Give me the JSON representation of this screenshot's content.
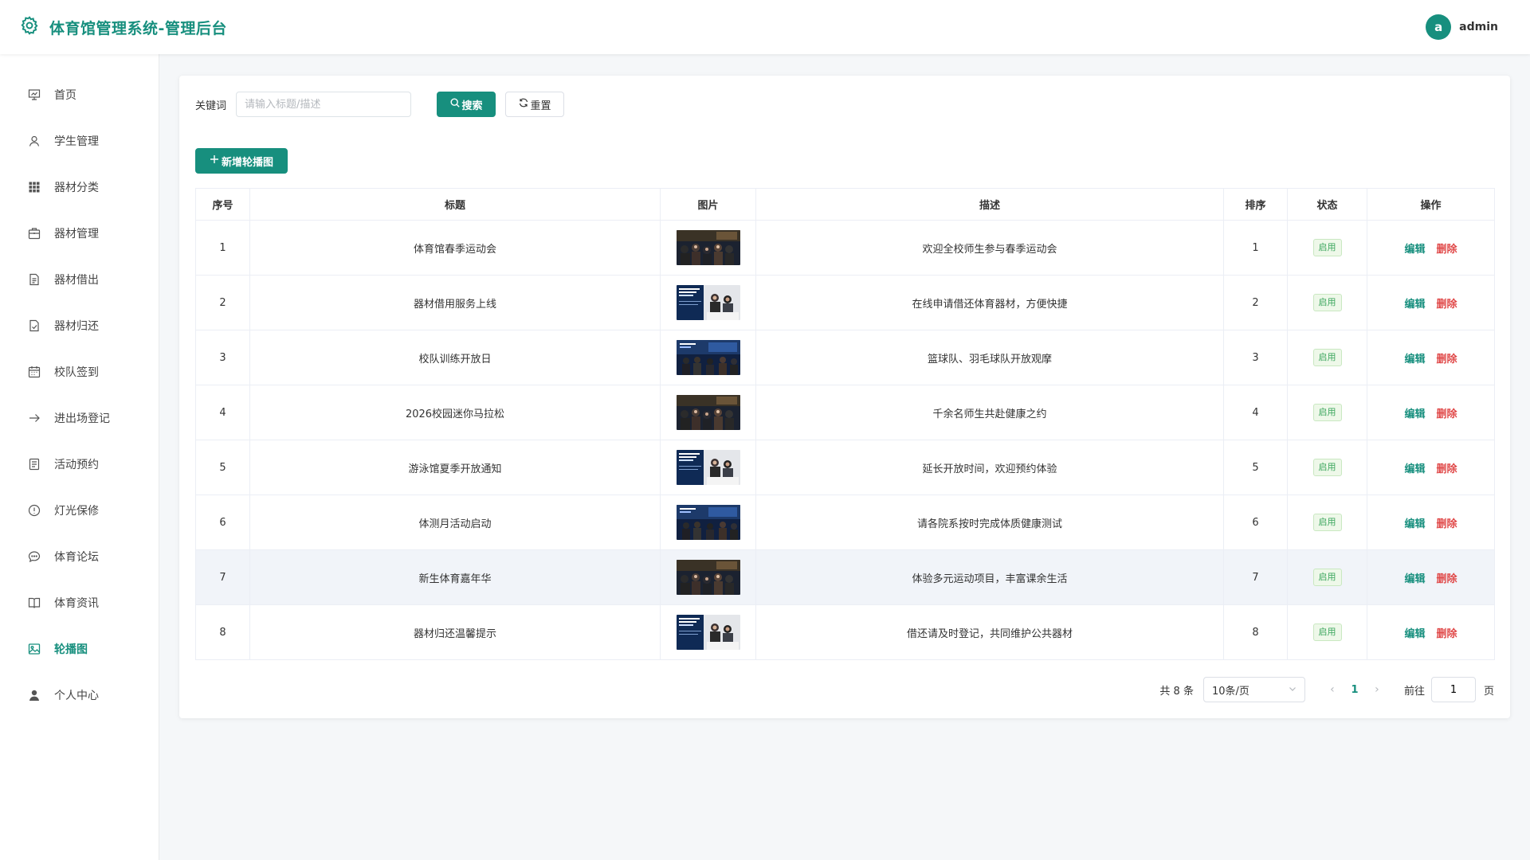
{
  "header": {
    "title": "体育馆管理系统-管理后台",
    "user_initial": "a",
    "username": "admin"
  },
  "sidebar": {
    "items": [
      {
        "label": "首页",
        "icon": "presentation-icon"
      },
      {
        "label": "学生管理",
        "icon": "user-icon"
      },
      {
        "label": "器材分类",
        "icon": "grid-icon"
      },
      {
        "label": "器材管理",
        "icon": "box-icon"
      },
      {
        "label": "器材借出",
        "icon": "document-icon"
      },
      {
        "label": "器材归还",
        "icon": "document-check-icon"
      },
      {
        "label": "校队签到",
        "icon": "calendar-icon"
      },
      {
        "label": "进出场登记",
        "icon": "arrow-right-icon"
      },
      {
        "label": "活动预约",
        "icon": "note-icon"
      },
      {
        "label": "灯光保修",
        "icon": "alert-circle-icon"
      },
      {
        "label": "体育论坛",
        "icon": "chat-icon"
      },
      {
        "label": "体育资讯",
        "icon": "book-icon"
      },
      {
        "label": "轮播图",
        "icon": "picture-icon",
        "active": true
      },
      {
        "label": "个人中心",
        "icon": "person-icon"
      }
    ]
  },
  "search": {
    "label": "关键词",
    "placeholder": "请输入标题/描述",
    "search_label": "搜索",
    "reset_label": "重置"
  },
  "toolbar": {
    "add_label": "新增轮播图"
  },
  "table": {
    "headers": [
      "序号",
      "标题",
      "图片",
      "描述",
      "排序",
      "状态",
      "操作"
    ],
    "rows": [
      {
        "no": "1",
        "title": "体育馆春季运动会",
        "desc": "欢迎全校师生参与春季运动会",
        "sort": "1",
        "status": "启用"
      },
      {
        "no": "2",
        "title": "器材借用服务上线",
        "desc": "在线申请借还体育器材，方便快捷",
        "sort": "2",
        "status": "启用"
      },
      {
        "no": "3",
        "title": "校队训练开放日",
        "desc": "篮球队、羽毛球队开放观摩",
        "sort": "3",
        "status": "启用"
      },
      {
        "no": "4",
        "title": "2026校园迷你马拉松",
        "desc": "千余名师生共赴健康之约",
        "sort": "4",
        "status": "启用"
      },
      {
        "no": "5",
        "title": "游泳馆夏季开放通知",
        "desc": "延长开放时间，欢迎预约体验",
        "sort": "5",
        "status": "启用"
      },
      {
        "no": "6",
        "title": "体测月活动启动",
        "desc": "请各院系按时完成体质健康测试",
        "sort": "6",
        "status": "启用"
      },
      {
        "no": "7",
        "title": "新生体育嘉年华",
        "desc": "体验多元运动项目，丰富课余生活",
        "sort": "7",
        "status": "启用"
      },
      {
        "no": "8",
        "title": "器材归还温馨提示",
        "desc": "借还请及时登记，共同维护公共器材",
        "sort": "8",
        "status": "启用"
      }
    ],
    "edit_label": "编辑",
    "delete_label": "删除"
  },
  "pagination": {
    "total": "共 8 条",
    "page_size": "10条/页",
    "current": "1",
    "goto_label": "前往",
    "goto_value": "1",
    "goto_unit": "页"
  },
  "colors": {
    "brand": "#178f7e",
    "danger": "#e04848",
    "tag_green": "#3aa55c"
  }
}
